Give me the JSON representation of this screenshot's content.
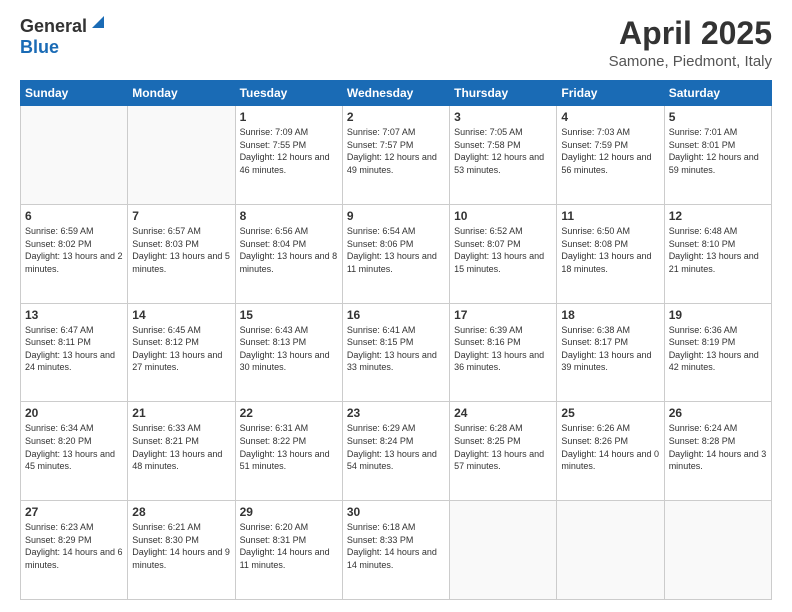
{
  "header": {
    "logo_general": "General",
    "logo_blue": "Blue",
    "title": "April 2025",
    "location": "Samone, Piedmont, Italy"
  },
  "weekdays": [
    "Sunday",
    "Monday",
    "Tuesday",
    "Wednesday",
    "Thursday",
    "Friday",
    "Saturday"
  ],
  "weeks": [
    [
      {
        "day": "",
        "info": ""
      },
      {
        "day": "",
        "info": ""
      },
      {
        "day": "1",
        "info": "Sunrise: 7:09 AM\nSunset: 7:55 PM\nDaylight: 12 hours and 46 minutes."
      },
      {
        "day": "2",
        "info": "Sunrise: 7:07 AM\nSunset: 7:57 PM\nDaylight: 12 hours and 49 minutes."
      },
      {
        "day": "3",
        "info": "Sunrise: 7:05 AM\nSunset: 7:58 PM\nDaylight: 12 hours and 53 minutes."
      },
      {
        "day": "4",
        "info": "Sunrise: 7:03 AM\nSunset: 7:59 PM\nDaylight: 12 hours and 56 minutes."
      },
      {
        "day": "5",
        "info": "Sunrise: 7:01 AM\nSunset: 8:01 PM\nDaylight: 12 hours and 59 minutes."
      }
    ],
    [
      {
        "day": "6",
        "info": "Sunrise: 6:59 AM\nSunset: 8:02 PM\nDaylight: 13 hours and 2 minutes."
      },
      {
        "day": "7",
        "info": "Sunrise: 6:57 AM\nSunset: 8:03 PM\nDaylight: 13 hours and 5 minutes."
      },
      {
        "day": "8",
        "info": "Sunrise: 6:56 AM\nSunset: 8:04 PM\nDaylight: 13 hours and 8 minutes."
      },
      {
        "day": "9",
        "info": "Sunrise: 6:54 AM\nSunset: 8:06 PM\nDaylight: 13 hours and 11 minutes."
      },
      {
        "day": "10",
        "info": "Sunrise: 6:52 AM\nSunset: 8:07 PM\nDaylight: 13 hours and 15 minutes."
      },
      {
        "day": "11",
        "info": "Sunrise: 6:50 AM\nSunset: 8:08 PM\nDaylight: 13 hours and 18 minutes."
      },
      {
        "day": "12",
        "info": "Sunrise: 6:48 AM\nSunset: 8:10 PM\nDaylight: 13 hours and 21 minutes."
      }
    ],
    [
      {
        "day": "13",
        "info": "Sunrise: 6:47 AM\nSunset: 8:11 PM\nDaylight: 13 hours and 24 minutes."
      },
      {
        "day": "14",
        "info": "Sunrise: 6:45 AM\nSunset: 8:12 PM\nDaylight: 13 hours and 27 minutes."
      },
      {
        "day": "15",
        "info": "Sunrise: 6:43 AM\nSunset: 8:13 PM\nDaylight: 13 hours and 30 minutes."
      },
      {
        "day": "16",
        "info": "Sunrise: 6:41 AM\nSunset: 8:15 PM\nDaylight: 13 hours and 33 minutes."
      },
      {
        "day": "17",
        "info": "Sunrise: 6:39 AM\nSunset: 8:16 PM\nDaylight: 13 hours and 36 minutes."
      },
      {
        "day": "18",
        "info": "Sunrise: 6:38 AM\nSunset: 8:17 PM\nDaylight: 13 hours and 39 minutes."
      },
      {
        "day": "19",
        "info": "Sunrise: 6:36 AM\nSunset: 8:19 PM\nDaylight: 13 hours and 42 minutes."
      }
    ],
    [
      {
        "day": "20",
        "info": "Sunrise: 6:34 AM\nSunset: 8:20 PM\nDaylight: 13 hours and 45 minutes."
      },
      {
        "day": "21",
        "info": "Sunrise: 6:33 AM\nSunset: 8:21 PM\nDaylight: 13 hours and 48 minutes."
      },
      {
        "day": "22",
        "info": "Sunrise: 6:31 AM\nSunset: 8:22 PM\nDaylight: 13 hours and 51 minutes."
      },
      {
        "day": "23",
        "info": "Sunrise: 6:29 AM\nSunset: 8:24 PM\nDaylight: 13 hours and 54 minutes."
      },
      {
        "day": "24",
        "info": "Sunrise: 6:28 AM\nSunset: 8:25 PM\nDaylight: 13 hours and 57 minutes."
      },
      {
        "day": "25",
        "info": "Sunrise: 6:26 AM\nSunset: 8:26 PM\nDaylight: 14 hours and 0 minutes."
      },
      {
        "day": "26",
        "info": "Sunrise: 6:24 AM\nSunset: 8:28 PM\nDaylight: 14 hours and 3 minutes."
      }
    ],
    [
      {
        "day": "27",
        "info": "Sunrise: 6:23 AM\nSunset: 8:29 PM\nDaylight: 14 hours and 6 minutes."
      },
      {
        "day": "28",
        "info": "Sunrise: 6:21 AM\nSunset: 8:30 PM\nDaylight: 14 hours and 9 minutes."
      },
      {
        "day": "29",
        "info": "Sunrise: 6:20 AM\nSunset: 8:31 PM\nDaylight: 14 hours and 11 minutes."
      },
      {
        "day": "30",
        "info": "Sunrise: 6:18 AM\nSunset: 8:33 PM\nDaylight: 14 hours and 14 minutes."
      },
      {
        "day": "",
        "info": ""
      },
      {
        "day": "",
        "info": ""
      },
      {
        "day": "",
        "info": ""
      }
    ]
  ]
}
